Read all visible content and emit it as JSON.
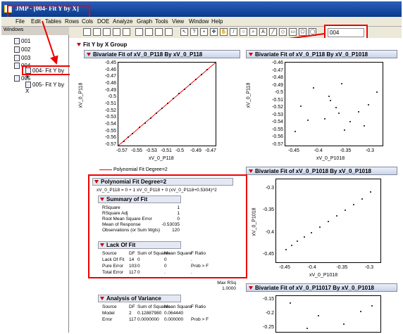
{
  "window": {
    "title": "JMP - [004- Fit Y by X]"
  },
  "menu": [
    "File",
    "Edit",
    "Tables",
    "Rows",
    "Cols",
    "DOE",
    "Analyze",
    "Graph",
    "Tools",
    "View",
    "Window",
    "Help"
  ],
  "toolbar_input": {
    "value": "004"
  },
  "windows_panel": {
    "header": "Windows",
    "items": [
      "001",
      "002",
      "003",
      "004",
      "004- Fit Y by X",
      "005",
      "005- Fit Y by X"
    ]
  },
  "report": {
    "group_title": "Fit Y by X Group",
    "panels": {
      "p1": "Bivariate Fit of xV_0_P118 By xV_0_P118",
      "p2": "Bivariate Fit of xV_0_P118 By xV_0_P1018",
      "p3": "Bivariate Fit of xV_0_P1018 By xV_0_P1018",
      "p4": "Bivariate Fit of xV_0_P11017 By xV_0_P1018"
    },
    "legend_poly": "Polynomial Fit Degree=2",
    "poly_title": "Polynomial Fit Degree=2",
    "equation": "xV_0_P118 = 0 + 1 xV_0_P118 + 0 (xV_0_P118+0.5304)^2",
    "summary": {
      "title": "Summary of Fit",
      "rows": [
        [
          "RSquare",
          "1"
        ],
        [
          "RSquare Adj",
          "1"
        ],
        [
          "Root Mean Square Error",
          "0"
        ],
        [
          "Mean of Response",
          "-0.53035"
        ],
        [
          "Observations (or Sum Wgts)",
          "120"
        ]
      ]
    },
    "lof": {
      "title": "Lack Of Fit",
      "header": [
        "Source",
        "DF",
        "Sum of Squares",
        "Mean Square",
        "F Ratio"
      ],
      "rows": [
        [
          "Lack Of Fit",
          "14",
          "0",
          "0",
          "."
        ],
        [
          "Pure Error",
          "103",
          "0",
          "0",
          "Prob > F"
        ],
        [
          "Total Error",
          "117",
          "0",
          ".",
          "."
        ]
      ]
    },
    "maxrsq": {
      "label": "Max RSq",
      "value": "1.0000"
    },
    "anova": {
      "title": "Analysis of Variance",
      "header": [
        "Source",
        "DF",
        "Sum of Squares",
        "Mean Square",
        "F Ratio"
      ],
      "rows": [
        [
          "Model",
          "2",
          "0.12887980",
          "0.064440",
          ""
        ],
        [
          "Error",
          "117",
          "0.0000000",
          "0.000000",
          "Prob > F"
        ]
      ]
    },
    "plot1": {
      "ylabel": "xV_0_P118",
      "xlabel": "xV_0_P118",
      "yticks": [
        "-0.45",
        "-0.46",
        "-0.47",
        "-0.48",
        "-0.49",
        "-0.5",
        "-0.51",
        "-0.52",
        "-0.53",
        "-0.54",
        "-0.55",
        "-0.56",
        "-0.57"
      ],
      "xticks": [
        "-0.57",
        "-0.55",
        "-0.53",
        "-0.51",
        "-0.5",
        "-0.49",
        "-0.47"
      ]
    },
    "plot2": {
      "ylabel": "xV_0_P118",
      "xlabel": "xV_0_P1018",
      "yticks": [
        "-0.46",
        "-0.47",
        "-0.48",
        "-0.49",
        "-0.5",
        "-0.51",
        "-0.52",
        "-0.53",
        "-0.54",
        "-0.55",
        "-0.56",
        "-0.57"
      ],
      "xticks": [
        "-0.45",
        "-0.4",
        "-0.35",
        "-0.3"
      ]
    },
    "plot3": {
      "ylabel": "xV_0_P1018",
      "xlabel": "xV_0_P1018",
      "yticks": [
        "-0.3",
        "-0.35",
        "-0.4",
        "-0.45"
      ],
      "xticks": [
        "-0.45",
        "-0.4",
        "-0.35",
        "-0.3"
      ]
    },
    "plot4": {
      "yticks": [
        "-0.15",
        "-0.2",
        "-0.25"
      ]
    }
  },
  "colors": {
    "title_bar": "#0a3a8c",
    "highlight": "#e00000",
    "fit_line": "#e00000"
  }
}
